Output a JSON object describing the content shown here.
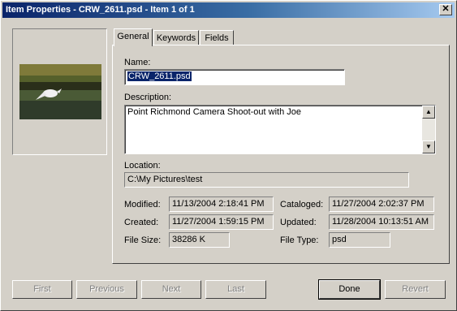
{
  "window": {
    "title": "Item Properties - CRW_2611.psd - Item 1 of 1",
    "close_glyph": "✕"
  },
  "tabs": [
    {
      "label": "General"
    },
    {
      "label": "Keywords"
    },
    {
      "label": "Fields"
    }
  ],
  "general": {
    "name_label": "Name:",
    "name_value": "CRW_2611.psd",
    "description_label": "Description:",
    "description_value": "Point Richmond Camera Shoot-out with Joe",
    "location_label": "Location:",
    "location_value": "C:\\My Pictures\\test",
    "modified_label": "Modified:",
    "modified_value": "11/13/2004 2:18:41 PM",
    "created_label": "Created:",
    "created_value": "11/27/2004 1:59:15 PM",
    "filesize_label": "File Size:",
    "filesize_value": "38286 K",
    "cataloged_label": "Cataloged:",
    "cataloged_value": "11/27/2004 2:02:37 PM",
    "updated_label": "Updated:",
    "updated_value": "11/28/2004 10:13:51 AM",
    "filetype_label": "File Type:",
    "filetype_value": "psd"
  },
  "buttons": {
    "first": "First",
    "previous": "Previous",
    "next": "Next",
    "last": "Last",
    "done": "Done",
    "revert": "Revert"
  },
  "colors": {
    "title_start": "#0a246a",
    "title_end": "#a6caf0",
    "dialog_bg": "#d4d0c8"
  }
}
